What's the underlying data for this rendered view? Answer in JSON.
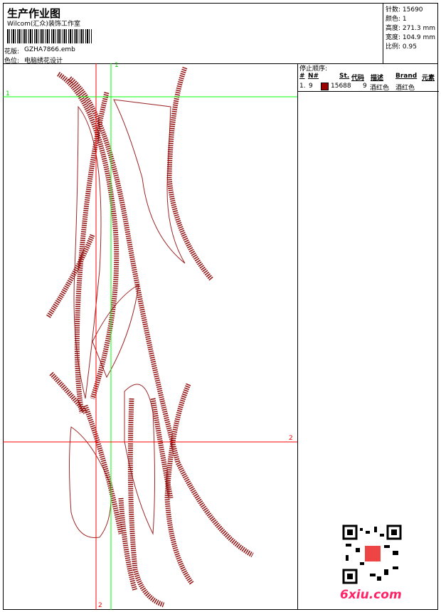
{
  "header": {
    "title": "生产作业图",
    "company": "Wilcom(汇众)装饰工作室",
    "design_label": "花版:",
    "design_file": "GZHA7866.emb",
    "color_label": "色位:",
    "color_value": "电脑绣花设计"
  },
  "info": {
    "stitches": "针数: 15690",
    "colors": "颜色: 1",
    "height": "高度: 271.3 mm",
    "width": "宽度: 104.9 mm",
    "scale": "比例: 0.95"
  },
  "stop_sequence": {
    "title": "停止顺序:",
    "headers": [
      "#",
      "N#",
      "St.",
      "代码",
      "描述",
      "Brand",
      "元素"
    ],
    "rows": [
      {
        "index": "1.",
        "n": "9",
        "color": "#9b0000",
        "stitches": "15688",
        "code": "9",
        "description": "酒红色",
        "brand": "酒红色"
      }
    ]
  },
  "guides": {
    "v1": "1",
    "h1": "1",
    "h2": "2",
    "v2": "2"
  },
  "watermark": "6xiu.com",
  "colors": {
    "thread": "#8b0000",
    "guide_red": "#ff0000",
    "guide_green": "#00ff00"
  }
}
